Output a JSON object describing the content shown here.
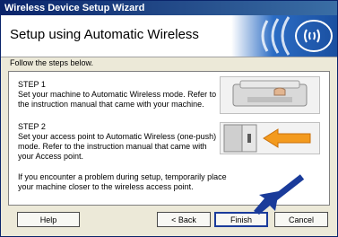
{
  "window": {
    "title": "Wireless Device Setup Wizard"
  },
  "header": {
    "title": "Setup using Automatic Wireless"
  },
  "instructions": "Follow the steps below.",
  "steps": [
    {
      "heading": "STEP 1",
      "text": "Set your machine to Automatic Wireless mode. Refer to the instruction manual that came with your machine."
    },
    {
      "heading": "STEP 2",
      "text": "Set your access point to Automatic Wireless (one-push) mode. Refer to the instruction manual that came with your Access point."
    }
  ],
  "note": "If you encounter a problem during setup, temporarily place your machine closer to the wireless access point.",
  "buttons": {
    "help": "Help",
    "back": "< Back",
    "finish": "Finish",
    "cancel": "Cancel"
  },
  "colors": {
    "titlebar": "#0a246a",
    "banner": "#2b6cc4",
    "arrow": "#1a3b9a",
    "accent_orange": "#f39a1e"
  }
}
